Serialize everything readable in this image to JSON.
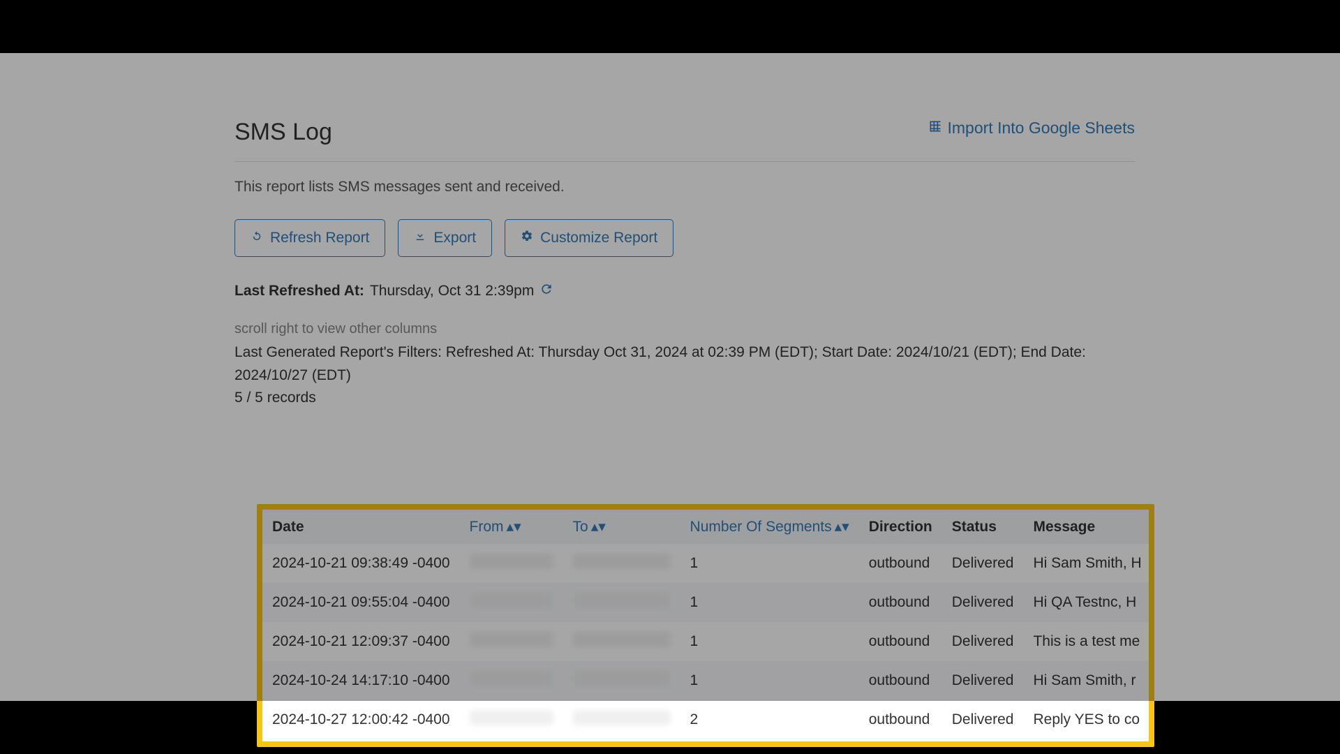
{
  "header": {
    "title": "SMS Log",
    "import_label": "Import Into Google Sheets"
  },
  "description": "This report lists SMS messages sent and received.",
  "buttons": {
    "refresh": "Refresh Report",
    "export": "Export",
    "customize": "Customize Report"
  },
  "last_refreshed": {
    "label": "Last Refreshed At:",
    "value": "Thursday, Oct 31 2:39pm"
  },
  "scroll_hint": "scroll right to view other columns",
  "filters_line": "Last Generated Report's Filters: Refreshed At: Thursday Oct 31, 2024 at 02:39 PM (EDT); Start Date: 2024/10/21 (EDT); End Date: 2024/10/27 (EDT)",
  "records": "5 / 5 records",
  "table": {
    "columns": {
      "date": "Date",
      "from": "From",
      "to": "To",
      "segments": "Number Of Segments",
      "direction": "Direction",
      "status": "Status",
      "message": "Message"
    },
    "rows": [
      {
        "date": "2024-10-21 09:38:49 -0400",
        "from": "",
        "to": "",
        "segments": "1",
        "direction": "outbound",
        "status": "Delivered",
        "message": "Hi Sam Smith, H"
      },
      {
        "date": "2024-10-21 09:55:04 -0400",
        "from": "",
        "to": "",
        "segments": "1",
        "direction": "outbound",
        "status": "Delivered",
        "message": "Hi QA Testnc, H"
      },
      {
        "date": "2024-10-21 12:09:37 -0400",
        "from": "",
        "to": "",
        "segments": "1",
        "direction": "outbound",
        "status": "Delivered",
        "message": "This is a test me"
      },
      {
        "date": "2024-10-24 14:17:10 -0400",
        "from": "",
        "to": "",
        "segments": "1",
        "direction": "outbound",
        "status": "Delivered",
        "message": "Hi Sam Smith, r"
      },
      {
        "date": "2024-10-27 12:00:42 -0400",
        "from": "",
        "to": "",
        "segments": "2",
        "direction": "outbound",
        "status": "Delivered",
        "message": "Reply YES to co"
      }
    ]
  }
}
